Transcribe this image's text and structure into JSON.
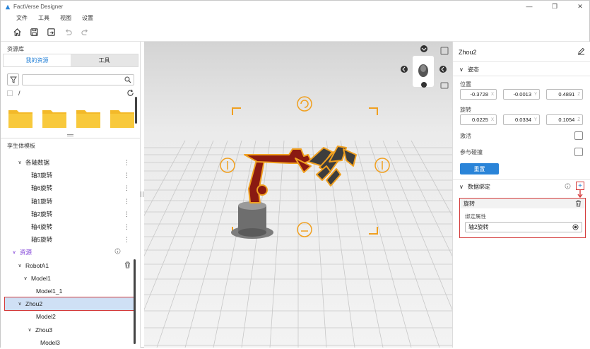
{
  "app": {
    "title": "FactVerse Designer"
  },
  "menu": [
    "文件",
    "工具",
    "视图",
    "设置"
  ],
  "left_panel": {
    "library_title": "资源库",
    "tabs": [
      "我的资源",
      "工具"
    ],
    "search": {
      "placeholder": "",
      "value": ""
    },
    "path": "/",
    "twin_template_title": "孪生体模板",
    "tree": [
      {
        "label": "各轴数据",
        "level": 1,
        "expanded": true,
        "more": "⋮"
      },
      {
        "label": "轴3旋转",
        "level": 2,
        "more": "⋮"
      },
      {
        "label": "轴6旋转",
        "level": 2,
        "more": "⋮"
      },
      {
        "label": "轴1旋转",
        "level": 2,
        "more": "⋮"
      },
      {
        "label": "轴2旋转",
        "level": 2,
        "more": "⋮"
      },
      {
        "label": "轴4旋转",
        "level": 2,
        "more": "⋮"
      },
      {
        "label": "轴5旋转",
        "level": 2,
        "more": "⋮"
      },
      {
        "label": "资源",
        "level": 0,
        "expanded": true,
        "purple": true,
        "info": true
      },
      {
        "label": "RobotA1",
        "level": 1,
        "expanded": true,
        "trash": true
      },
      {
        "label": "Model1",
        "level": 2,
        "expanded": true
      },
      {
        "label": "Model1_1",
        "level": 3
      },
      {
        "label": "Zhou2",
        "level": 1,
        "expanded": true,
        "selected": true
      },
      {
        "label": "Model2",
        "level": 3
      },
      {
        "label": "Zhou3",
        "level": 2,
        "expanded": true
      },
      {
        "label": "Model3",
        "level": 4
      }
    ]
  },
  "right_panel": {
    "object_name": "Zhou2",
    "pose_section": "姿态",
    "position_label": "位置",
    "position": [
      {
        "value": "-0.3728",
        "axis": "X"
      },
      {
        "value": "-0.0013",
        "axis": "Y"
      },
      {
        "value": "0.4891",
        "axis": "Z"
      }
    ],
    "rotation_label": "旋转",
    "rotation": [
      {
        "value": "0.0225",
        "axis": "X"
      },
      {
        "value": "0.0334",
        "axis": "Y"
      },
      {
        "value": "0.1054",
        "axis": "Z"
      }
    ],
    "active_label": "激活",
    "collision_label": "参与碰撞",
    "reset_label": "重置",
    "binding_section": "数据绑定",
    "binding": {
      "name": "旋转",
      "property_label": "绑定属性",
      "property_value": "轴2旋转"
    }
  },
  "colors": {
    "accent": "#2a84d8",
    "highlight": "#d43a3a",
    "robot": "#8a1a12",
    "outline": "#f0a020"
  }
}
